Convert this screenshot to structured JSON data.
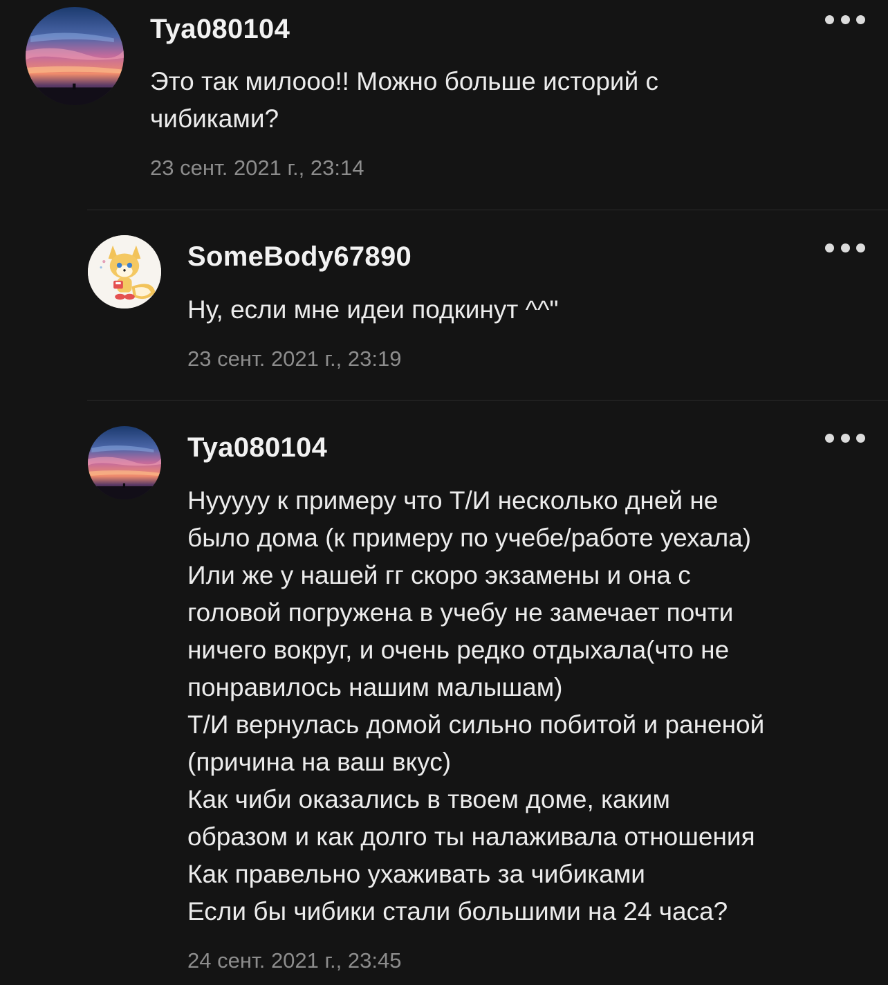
{
  "comments": [
    {
      "username": "Tya080104",
      "text": "Это так милооо!! Можно больше историй с\nчибиками?",
      "timestamp": "23 сент. 2021 г., 23:14",
      "avatar": "sunset-sky-avatar"
    },
    {
      "username": "SomeBody67890",
      "text": "Ну, если мне идеи подкинут ^^\"",
      "timestamp": "23 сент. 2021 г., 23:19",
      "avatar": "fox-character-avatar"
    },
    {
      "username": "Tya080104",
      "text": "Нууууу к примеру что Т/И несколько дней не\nбыло дома (к примеру по учебе/работе уехала)\nИли же у нашей гг скоро экзамены и она с\nголовой погружена в учебу не замечает почти\nничего вокруг, и очень редко отдыхала(что не\nпонравилось нашим малышам)\nТ/И вернулась домой сильно побитой и раненой\n(причина на ваш вкус)\nКак чиби оказались в твоем доме,  каким\nобразом и как долго ты налаживала отношения\nКак правельно ухаживать за чибиками\nЕсли бы чибики стали большими на 24 часа?",
      "timestamp": "24 сент. 2021 г., 23:45",
      "avatar": "sunset-sky-avatar"
    }
  ],
  "icons": {
    "more": "more-options-icon"
  },
  "colors": {
    "background": "#141414",
    "text": "#ececec",
    "timestamp": "#8d8d8d",
    "divider": "#2c2c2c"
  }
}
